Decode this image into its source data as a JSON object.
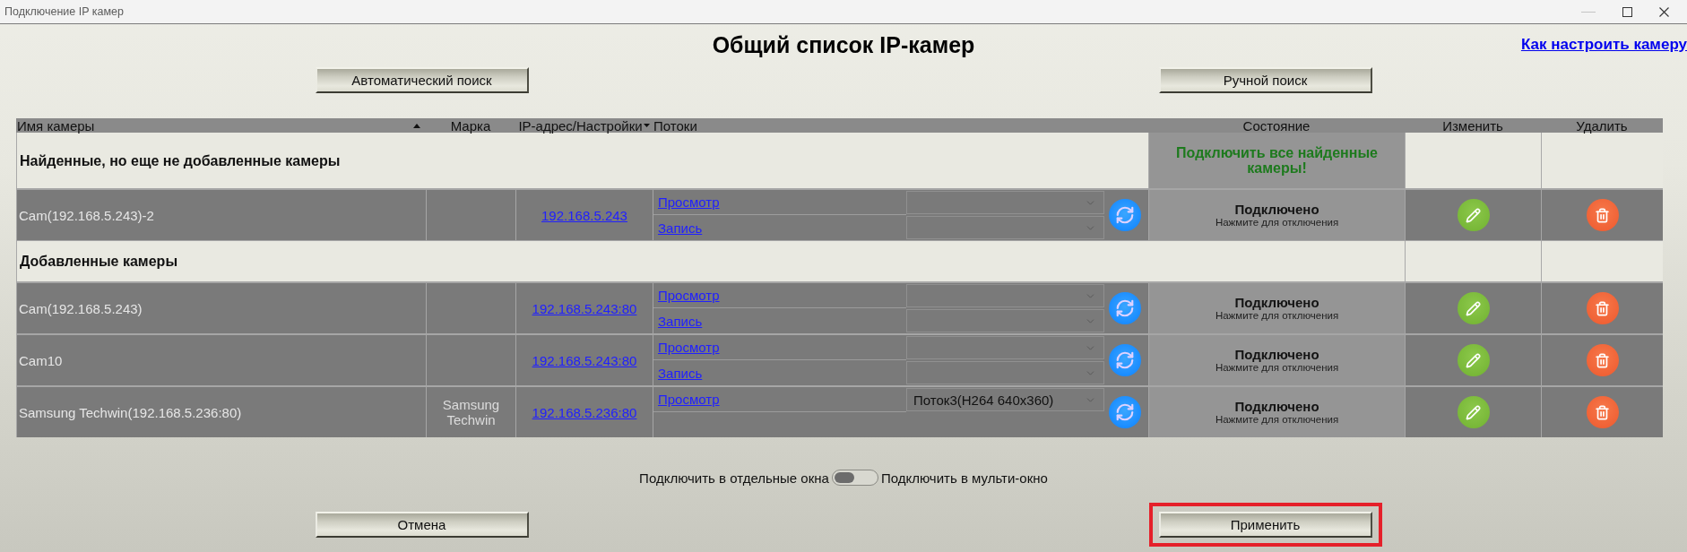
{
  "window": {
    "title": "Подключение IP камер"
  },
  "page": {
    "title": "Общий список IP-камер",
    "help_link": "Как настроить камеру"
  },
  "search_buttons": [
    {
      "label": "Автоматический поиск"
    },
    {
      "label": "Ручной поиск"
    }
  ],
  "table": {
    "columns": [
      {
        "label": "Имя камеры",
        "sort_ascending": true
      },
      {
        "label": "Марка"
      },
      {
        "label": "IP-адрес/Настройки",
        "dropdown": true
      },
      {
        "label": "Потоки"
      },
      {
        "label": "Состояние"
      },
      {
        "label": "Изменить"
      },
      {
        "label": "Удалить"
      }
    ],
    "sections": [
      {
        "title": "Найденные, но еще не добавленные камеры",
        "action": "Подключить все найденные камеры!",
        "rows": [
          {
            "name": "Cam(192.168.5.243)-2",
            "address": "192.168.5.243",
            "streams": [
              {
                "link": "Просмотр"
              },
              {
                "link": "Запись"
              }
            ],
            "status": "Подключено",
            "hint": "Нажмите для отключения"
          }
        ]
      },
      {
        "title": "Добавленные камеры",
        "rows": [
          {
            "name": "Cam(192.168.5.243)",
            "address": "192.168.5.243:80",
            "streams": [
              {
                "link": "Просмотр"
              },
              {
                "link": "Запись"
              }
            ],
            "status": "Подключено",
            "hint": "Нажмите для отключения"
          },
          {
            "name": "Cam10",
            "address": "192.168.5.243:80",
            "streams": [
              {
                "link": "Просмотр"
              },
              {
                "link": "Запись"
              }
            ],
            "status": "Подключено",
            "hint": "Нажмите для отключения"
          },
          {
            "name": "Samsung Techwin(192.168.5.236:80)",
            "brand": "Samsung Techwin",
            "address": "192.168.5.236:80",
            "streams": [
              {
                "link": "Просмотр",
                "value": "Поток3(H264 640x360)"
              }
            ],
            "status": "Подключено",
            "hint": "Нажмите для отключения"
          }
        ]
      }
    ]
  },
  "display_mode": {
    "left_label": "Подключить в отдельные окна",
    "right_label": "Подключить в мульти-окно",
    "on": false
  },
  "footer_buttons": [
    {
      "label": "Отмена",
      "highlighted": false
    },
    {
      "label": "Применить",
      "highlighted": true
    }
  ]
}
